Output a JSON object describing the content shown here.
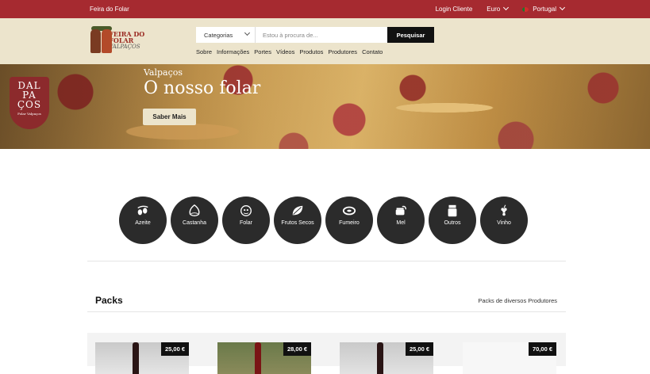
{
  "topbar": {
    "site_name": "Feira do Folar",
    "login": "Login Cliente",
    "currency": "Euro",
    "language": "Portugal"
  },
  "header": {
    "logo_line1": "FEIRA DO FOLAR",
    "logo_line2": "VALPAÇOS",
    "search": {
      "category": "Categorias",
      "placeholder": "Estou à procura de...",
      "button": "Pesquisar"
    },
    "nav": [
      "Sobre",
      "Informações",
      "Portes",
      "Vídeos",
      "Produtos",
      "Produtores",
      "Contato"
    ]
  },
  "hero": {
    "badge_lines": [
      "DAL",
      "PA",
      "ÇOS"
    ],
    "badge_sub": "Folar Valpaços",
    "kicker": "Valpaços",
    "title": "O nosso folar",
    "cta": "Saber Mais"
  },
  "categories": [
    {
      "label": "Azeite",
      "icon": "olive-icon"
    },
    {
      "label": "Castanha",
      "icon": "chestnut-icon"
    },
    {
      "label": "Folar",
      "icon": "folar-icon"
    },
    {
      "label": "Frutos Secos",
      "icon": "leaf-icon"
    },
    {
      "label": "Fumeiro",
      "icon": "sausage-icon"
    },
    {
      "label": "Mel",
      "icon": "honey-icon"
    },
    {
      "label": "Outros",
      "icon": "jar-icon"
    },
    {
      "label": "Vinho",
      "icon": "grapes-icon"
    }
  ],
  "packs": {
    "title": "Packs",
    "link": "Packs de diversos Produtores",
    "items": [
      {
        "price": "25,00 €"
      },
      {
        "price": "28,00 €"
      },
      {
        "price": "25,00 €"
      },
      {
        "price": "70,00 €"
      }
    ]
  },
  "colors": {
    "topbar": "#a62a30",
    "header": "#ece4cc",
    "category_circle": "#2b2b2b"
  }
}
